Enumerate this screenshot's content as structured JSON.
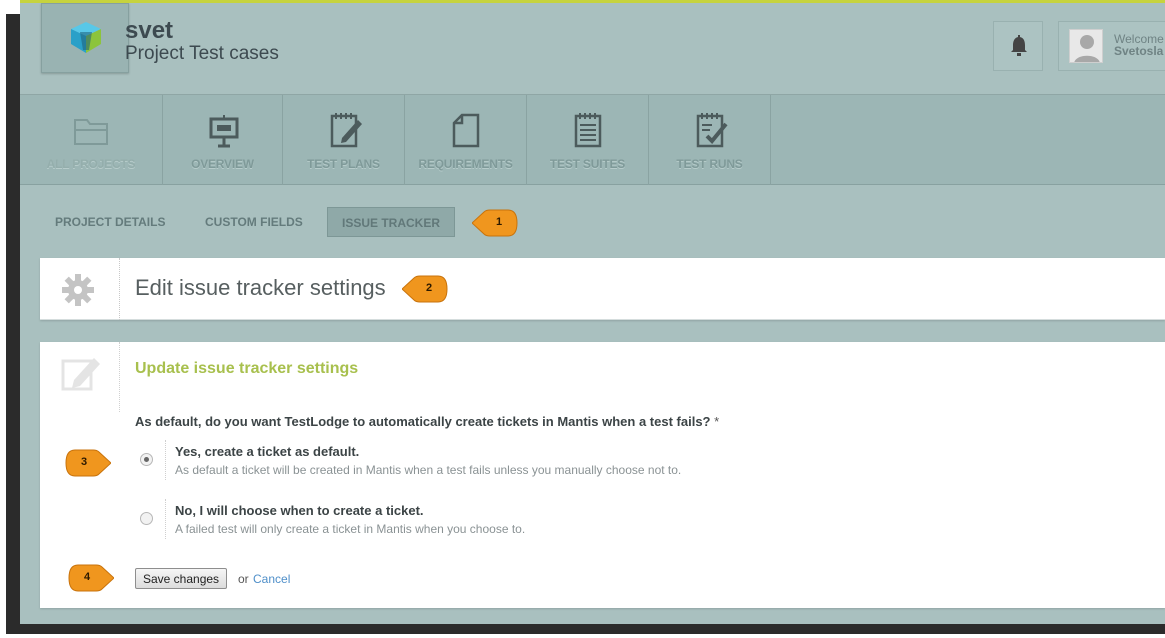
{
  "header": {
    "account_name": "svet",
    "project_name": "Project Test cases",
    "welcome_text": "Welcome",
    "user_name": "Svetosla"
  },
  "main_nav": {
    "items": [
      {
        "label": "ALL PROJECTS",
        "icon": "folder-icon"
      },
      {
        "label": "OVERVIEW",
        "icon": "presentation-board-icon"
      },
      {
        "label": "TEST PLANS",
        "icon": "notepad-pencil-icon"
      },
      {
        "label": "REQUIREMENTS",
        "icon": "document-icon"
      },
      {
        "label": "TEST SUITES",
        "icon": "notepad-lines-icon"
      },
      {
        "label": "TEST RUNS",
        "icon": "notepad-check-icon"
      }
    ]
  },
  "sub_nav": {
    "tabs": [
      {
        "label": "PROJECT DETAILS"
      },
      {
        "label": "CUSTOM FIELDS"
      },
      {
        "label": "ISSUE TRACKER",
        "active": true
      }
    ]
  },
  "callouts": [
    "1",
    "2",
    "3",
    "4"
  ],
  "title_panel": {
    "title": "Edit issue tracker settings",
    "icon": "gear-icon"
  },
  "form": {
    "section_title": "Update issue tracker settings",
    "question": "As default, do you want TestLodge to automatically create tickets in Mantis when a test fails?",
    "required_marker": "*",
    "options": [
      {
        "title": "Yes, create a ticket as default.",
        "description": "As default a ticket will be created in Mantis when a test fails unless you manually choose not to.",
        "checked": true
      },
      {
        "title": "No, I will choose when to create a ticket.",
        "description": "A failed test will only create a ticket in Mantis when you choose to.",
        "checked": false
      }
    ],
    "save_label": "Save changes",
    "or_text": "or",
    "cancel_label": "Cancel"
  },
  "colors": {
    "accent_green": "#a8c04e",
    "header_bg": "#a9c0bf",
    "callout_orange": "#f0961e",
    "link_blue": "#4f8fc9"
  }
}
